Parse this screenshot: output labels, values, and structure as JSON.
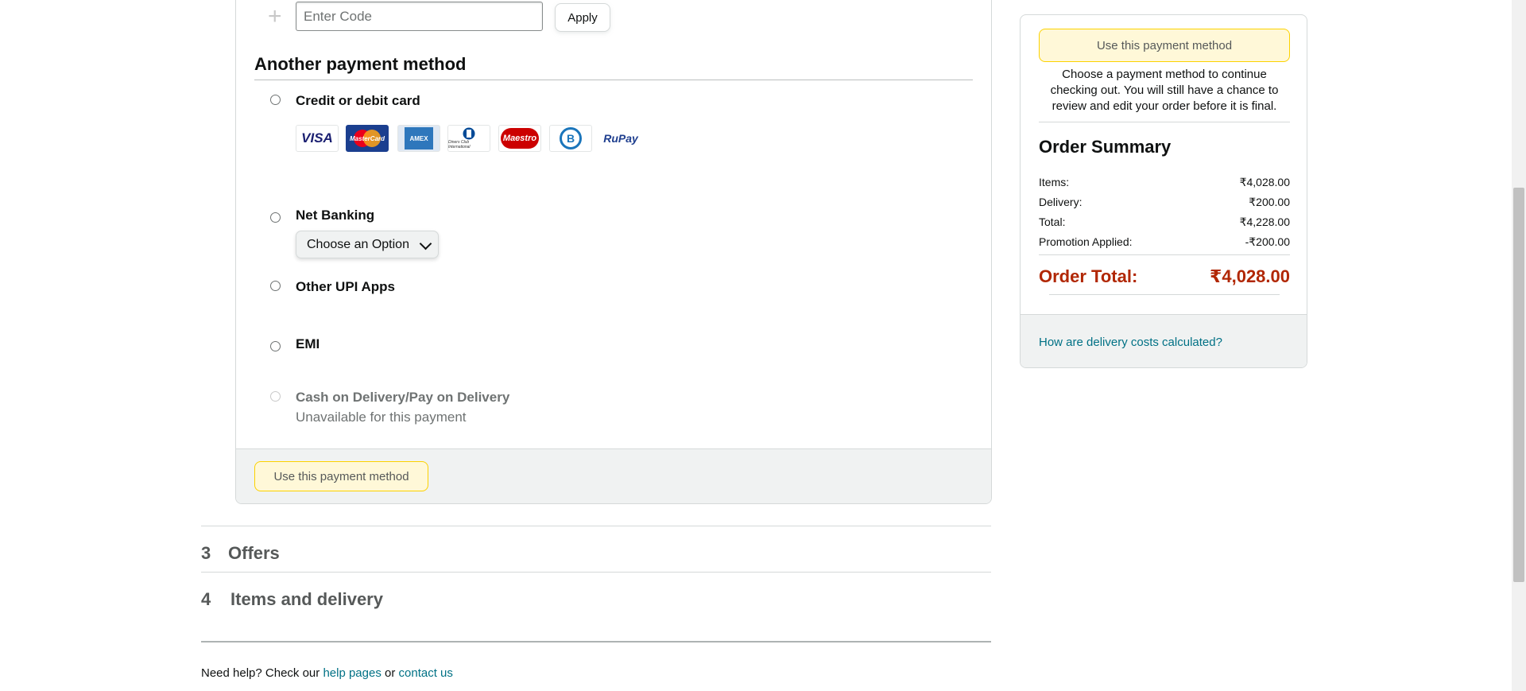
{
  "promo": {
    "plus_glyph": "+",
    "code_placeholder": "Enter Code",
    "apply_label": "Apply"
  },
  "payment": {
    "section_title": "Another payment method",
    "options": [
      {
        "label": "Credit or debit card",
        "enabled": true
      },
      {
        "label": "Net Banking",
        "enabled": true
      },
      {
        "label": "Other UPI Apps",
        "enabled": true
      },
      {
        "label": "EMI",
        "enabled": true
      },
      {
        "label": "Cash on Delivery/Pay on Delivery",
        "enabled": false,
        "note": "Unavailable for this payment"
      }
    ],
    "cards": [
      {
        "name": "visa-logo",
        "text": "VISA",
        "color": "#1a1f71"
      },
      {
        "name": "mastercard-logo",
        "text": "MasterCard",
        "color": "#eb001b"
      },
      {
        "name": "amex-logo",
        "text": "AMEX",
        "color": "#2e77bc"
      },
      {
        "name": "diners-club-logo",
        "text": "Diners Club International",
        "color": "#004a97"
      },
      {
        "name": "maestro-logo",
        "text": "Maestro",
        "color": "#cc0000"
      },
      {
        "name": "bajaj-finserv-logo",
        "text": "B",
        "color": "#1a75bb"
      },
      {
        "name": "rupay-logo",
        "text": "RuPay",
        "color": "#097a44"
      }
    ],
    "net_banking_select": "Choose an Option",
    "use_method_label": "Use this payment method"
  },
  "steps": [
    {
      "number": "3",
      "title": "Offers"
    },
    {
      "number": "4",
      "title": "Items and delivery"
    }
  ],
  "help": {
    "prefix": "Need help? Check our ",
    "help_link": "help pages",
    "middle": " or ",
    "contact_link": "contact us"
  },
  "summary": {
    "use_method_label": "Use this payment method",
    "note": "Choose a payment method to continue checking out. You will still have a chance to review and edit your order before it is final.",
    "title": "Order Summary",
    "rows": [
      {
        "label": "Items:",
        "value": "₹4,028.00"
      },
      {
        "label": "Delivery:",
        "value": "₹200.00"
      },
      {
        "label": "Total:",
        "value": "₹4,228.00"
      },
      {
        "label": "Promotion Applied:",
        "value": "-₹200.00"
      }
    ],
    "order_total_label": "Order Total:",
    "order_total_value": "₹4,028.00",
    "delivery_link": "How are delivery costs calculated?"
  },
  "colors": {
    "link": "#007185",
    "price_red": "#b12704",
    "yellow_btn_bg": "#fff8d8"
  }
}
